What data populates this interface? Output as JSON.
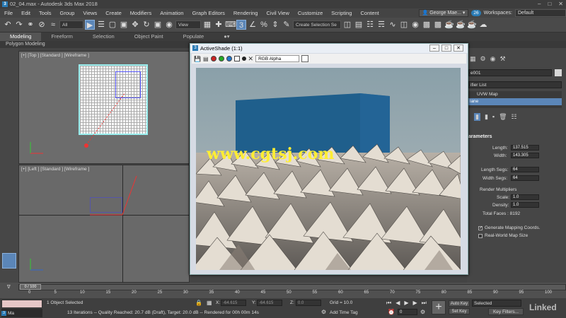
{
  "window": {
    "title": "02_04.max - Autodesk 3ds Max 2018",
    "app_icon": "3"
  },
  "menu": {
    "items": [
      "File",
      "Edit",
      "Tools",
      "Group",
      "Views",
      "Create",
      "Modifiers",
      "Animation",
      "Graph Editors",
      "Rendering",
      "Civil View",
      "Customize",
      "Scripting",
      "Content"
    ],
    "user": "George Mae...",
    "notifications": "26",
    "workspaces_label": "Workspaces:",
    "workspace_value": "Default"
  },
  "toolbar": {
    "selection_filter": "All",
    "ref_coord": "View",
    "named_selection": "Create Selection Se"
  },
  "ribbon": {
    "tabs": [
      "Modeling",
      "Freeform",
      "Selection",
      "Object Paint",
      "Populate"
    ],
    "sub_label": "Polygon Modeling"
  },
  "viewports": {
    "top_label": "[+] [Top ] [Standard ] [Wireframe ]",
    "left_label": "[+] [Left ] [Standard ] [Wireframe ]"
  },
  "activeshade": {
    "title": "ActiveShade (1:1)",
    "channel": "RGB Alpha",
    "watermark": "www.cgtsj.com",
    "colors": [
      "#cc2222",
      "#22aa22",
      "#2277cc"
    ]
  },
  "command_panel": {
    "object_name": "e001",
    "modifier_list": "ifier List",
    "stack": [
      "UVW Map",
      "lane"
    ],
    "rollout": "arameters",
    "length_label": "Length:",
    "length_value": "137.515",
    "width_label": "Width:",
    "width_value": "143.305",
    "length_segs_label": "Length Segs:",
    "length_segs_value": "64",
    "width_segs_label": "Width Segs:",
    "width_segs_value": "64",
    "render_mult": "Render Multipliers",
    "scale_label": "Scale:",
    "scale_value": "1.0",
    "density_label": "Density:",
    "density_value": "1.0",
    "total_faces": "Total Faces : 8192",
    "gen_map": "Generate Mapping Coords.",
    "real_world": "Real-World Map Size"
  },
  "timeline": {
    "slider": "0 / 100",
    "ticks": [
      "0",
      "5",
      "10",
      "15",
      "20",
      "25",
      "30",
      "35",
      "40",
      "45",
      "50",
      "55",
      "60",
      "65",
      "70",
      "75",
      "80",
      "85",
      "90",
      "95",
      "100"
    ]
  },
  "status": {
    "selected": "1 Object Selected",
    "message": "13 Iterations -- Quality Reached: 20.7 dB (Draft), Target: 20.0 dB -- Rendered for 00h 00m 14s",
    "x_label": "X:",
    "x_value": "-64.615",
    "y_label": "Y:",
    "y_value": "-64.615",
    "z_label": "Z:",
    "z_value": "0.0",
    "grid": "Grid = 10.0",
    "add_time_tag": "Add Time Tag",
    "maxscript": "Ma",
    "auto_key": "Auto Key",
    "set_key": "Set Key",
    "selected_dd": "Selected",
    "key_filters": "Key Filters...",
    "frame": "0",
    "logo": "Linked"
  }
}
